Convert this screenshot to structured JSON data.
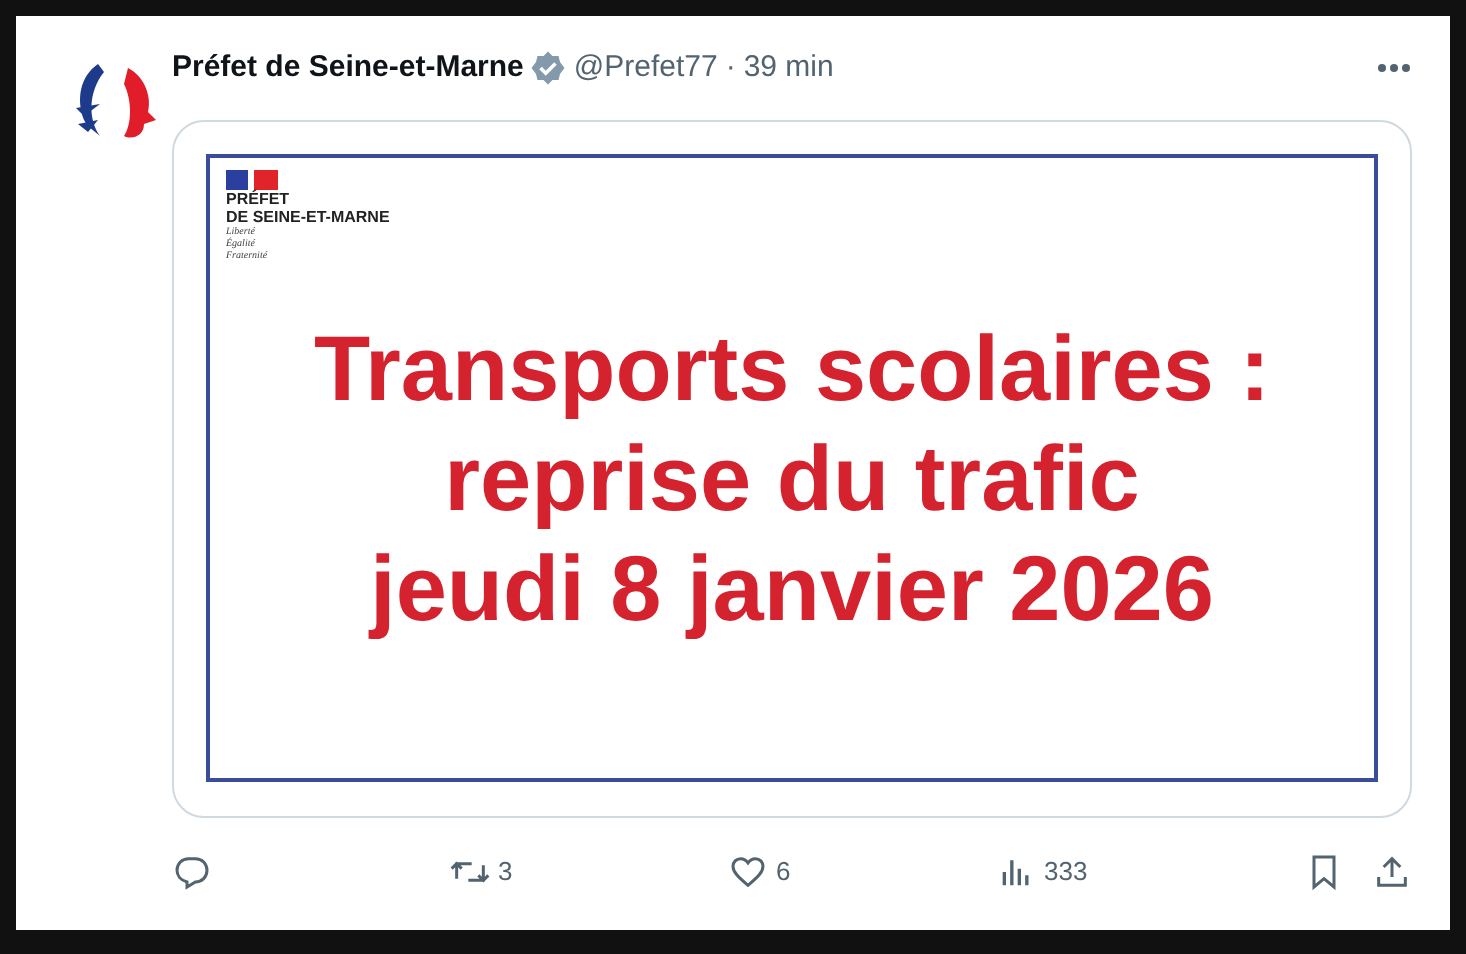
{
  "tweet": {
    "author": "Préfet de Seine-et-Marne",
    "verified": true,
    "handle": "@Prefet77",
    "separator": "·",
    "time": "39 min",
    "media": {
      "logo_lines": [
        "PRÉFET",
        "DE SEINE-ET-MARNE"
      ],
      "motto": [
        "Liberté",
        "Égalité",
        "Fraternité"
      ],
      "headline": [
        "Transports scolaires :",
        "reprise du trafic",
        "jeudi 8 janvier 2026"
      ]
    },
    "actions": [
      {
        "kind": "reply"
      },
      {
        "kind": "repost",
        "count": "3"
      },
      {
        "kind": "like",
        "count": "6"
      },
      {
        "kind": "views",
        "count": "333"
      }
    ],
    "side_actions": [
      {
        "kind": "bookmark"
      },
      {
        "kind": "share"
      }
    ]
  }
}
